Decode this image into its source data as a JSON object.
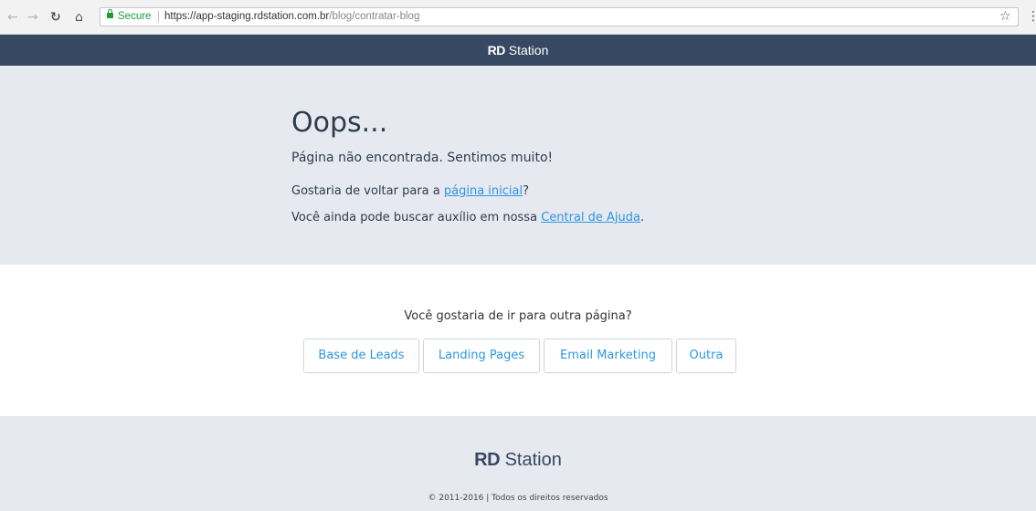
{
  "browser": {
    "secure_label": "Secure",
    "url_host": "https://app-staging.rdstation.com.br",
    "url_path": "/blog/contratar-blog"
  },
  "header": {
    "brand_strong": "RD",
    "brand_light": "Station"
  },
  "error": {
    "title": "Oops...",
    "subtitle": "Página não encontrada. Sentimos muito!",
    "line1_prefix": "Gostaria de voltar para a ",
    "line1_link": "página inicial",
    "line1_suffix": "?",
    "line2_prefix": "Você ainda pode buscar auxílio em nossa ",
    "line2_link": "Central de Ajuda",
    "line2_suffix": "."
  },
  "alternatives": {
    "question": "Você gostaria de ir para outra página?",
    "buttons": [
      "Base de Leads",
      "Landing Pages",
      "Email Marketing",
      "Outra"
    ]
  },
  "footer": {
    "brand_strong": "RD",
    "brand_light": "Station",
    "copyright": "© 2011-2016 | Todos os direitos reservados"
  },
  "colors": {
    "header_bg": "#374862",
    "section_bg": "#e6e9f0",
    "link": "#2d96e3",
    "secure_green": "#1a9b3c"
  }
}
